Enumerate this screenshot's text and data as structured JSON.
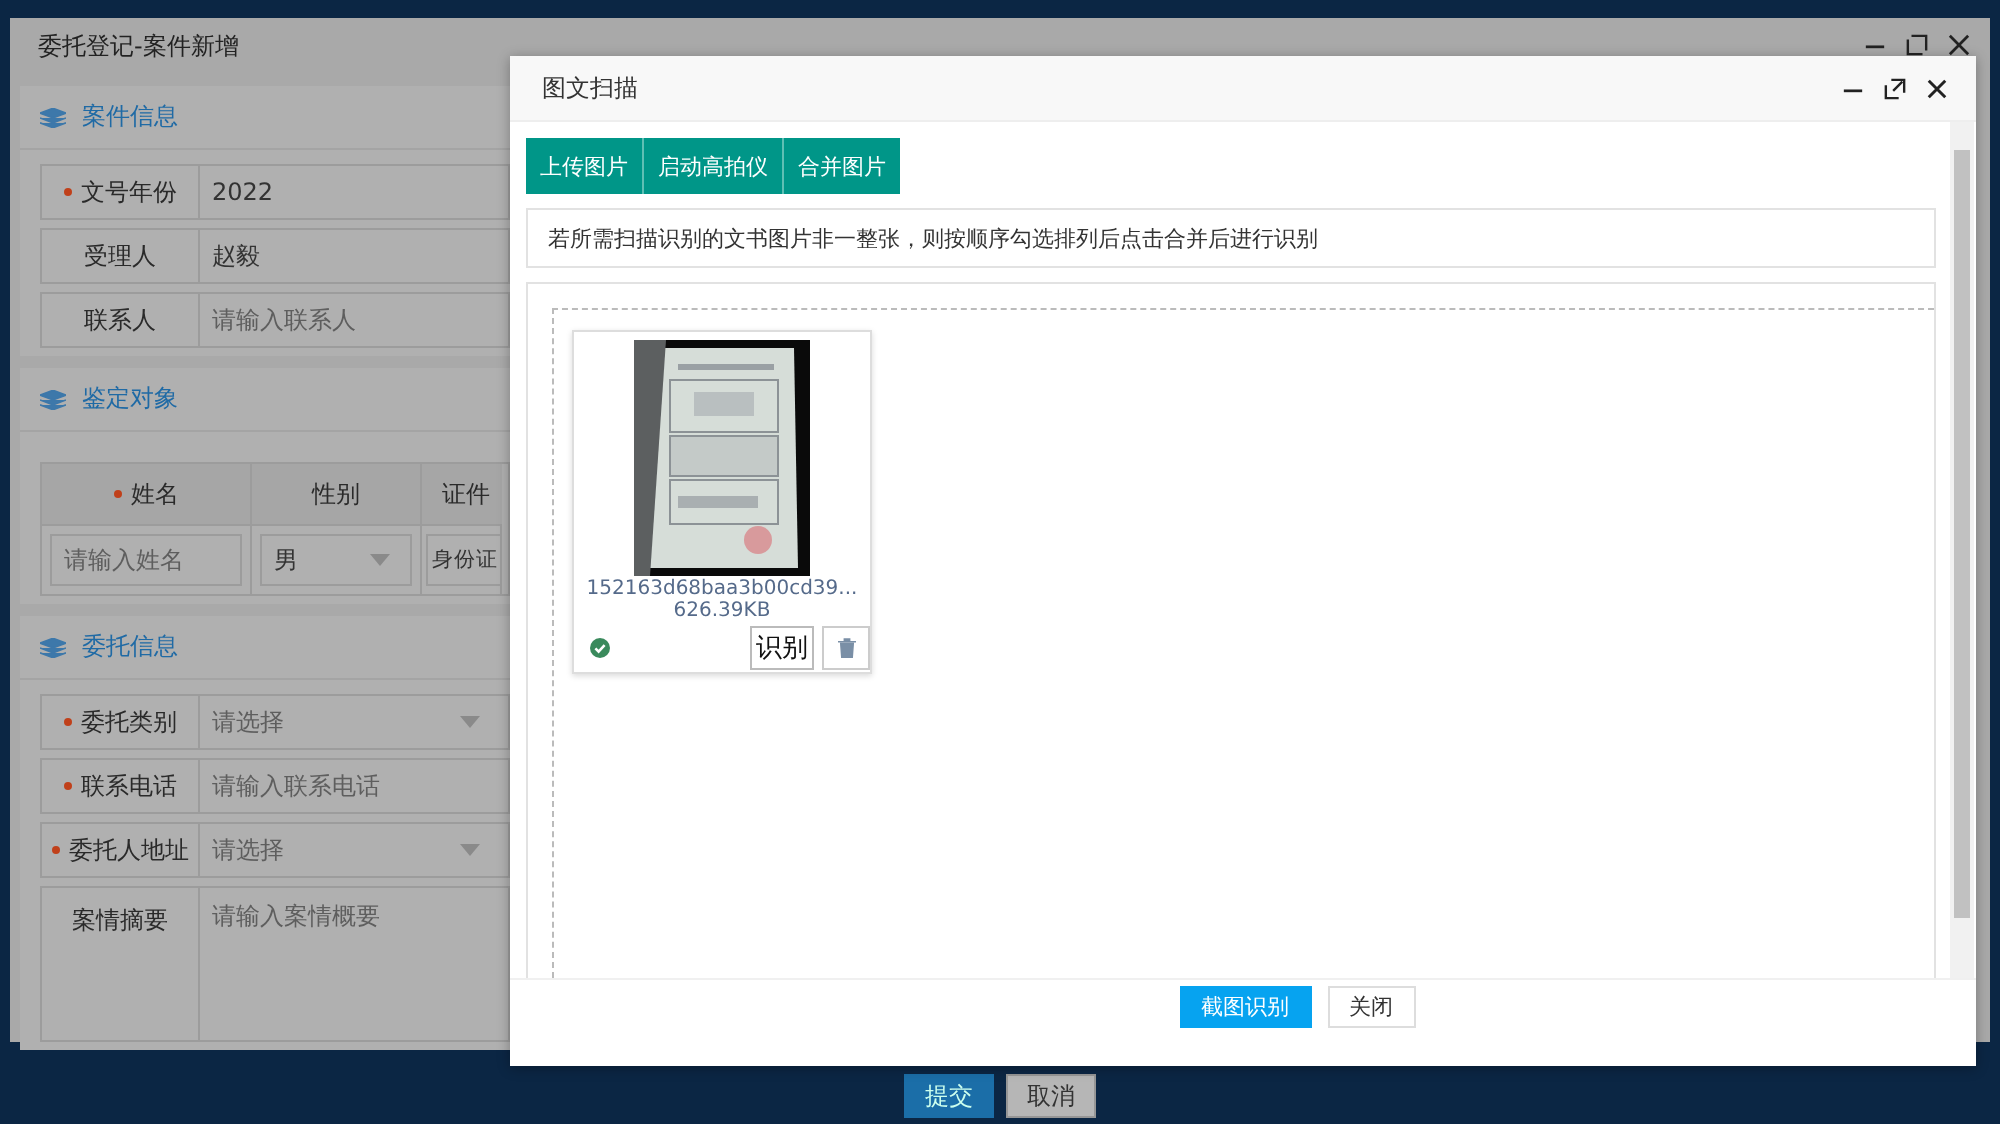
{
  "back_window": {
    "title": "委托登记-案件新增",
    "sections": [
      {
        "kind": "form",
        "title": "案件信息",
        "fields": [
          {
            "label": "文号年份",
            "required": true,
            "kind": "input",
            "value": "2022"
          },
          {
            "label": "受理人",
            "required": false,
            "kind": "input",
            "value": "赵毅"
          },
          {
            "label": "联系人",
            "required": false,
            "kind": "input",
            "placeholder": "请输入联系人"
          }
        ]
      },
      {
        "kind": "table",
        "title": "鉴定对象",
        "columns": [
          {
            "label": "姓名",
            "required": true
          },
          {
            "label": "性别",
            "required": false
          },
          {
            "label": "证件",
            "required": false
          }
        ],
        "rows": [
          [
            {
              "kind": "input",
              "placeholder": "请输入姓名"
            },
            {
              "kind": "select",
              "value": "男"
            },
            {
              "kind": "select",
              "value": "身份证"
            }
          ]
        ]
      },
      {
        "kind": "form",
        "title": "委托信息",
        "fields": [
          {
            "label": "委托类别",
            "required": true,
            "kind": "select",
            "placeholder": "请选择"
          },
          {
            "label": "联系电话",
            "required": true,
            "kind": "input",
            "placeholder": "请输入联系电话"
          },
          {
            "label": "委托人地址",
            "required": true,
            "kind": "select",
            "placeholder": "请选择"
          },
          {
            "label": "案情摘要",
            "required": false,
            "kind": "textarea",
            "placeholder": "请输入案情概要"
          }
        ]
      }
    ],
    "buttons": [
      {
        "label": "提交",
        "kind": "primary"
      },
      {
        "label": "取消",
        "kind": "default"
      }
    ]
  },
  "dialog": {
    "title": "图文扫描",
    "toolbar": [
      "上传图片",
      "启动高拍仪",
      "合并图片"
    ],
    "notice": "若所需扫描识别的文书图片非一整张，则按顺序勾选排列后点击合并后进行识别",
    "files": [
      {
        "kind": "picture",
        "name": "152163d68baa3b00cd39...",
        "size": "626.39KB",
        "recognized": true,
        "action": "识别"
      }
    ],
    "buttons": [
      {
        "label": "截图识别",
        "kind": "primary"
      },
      {
        "label": "关闭",
        "kind": "default"
      }
    ]
  }
}
